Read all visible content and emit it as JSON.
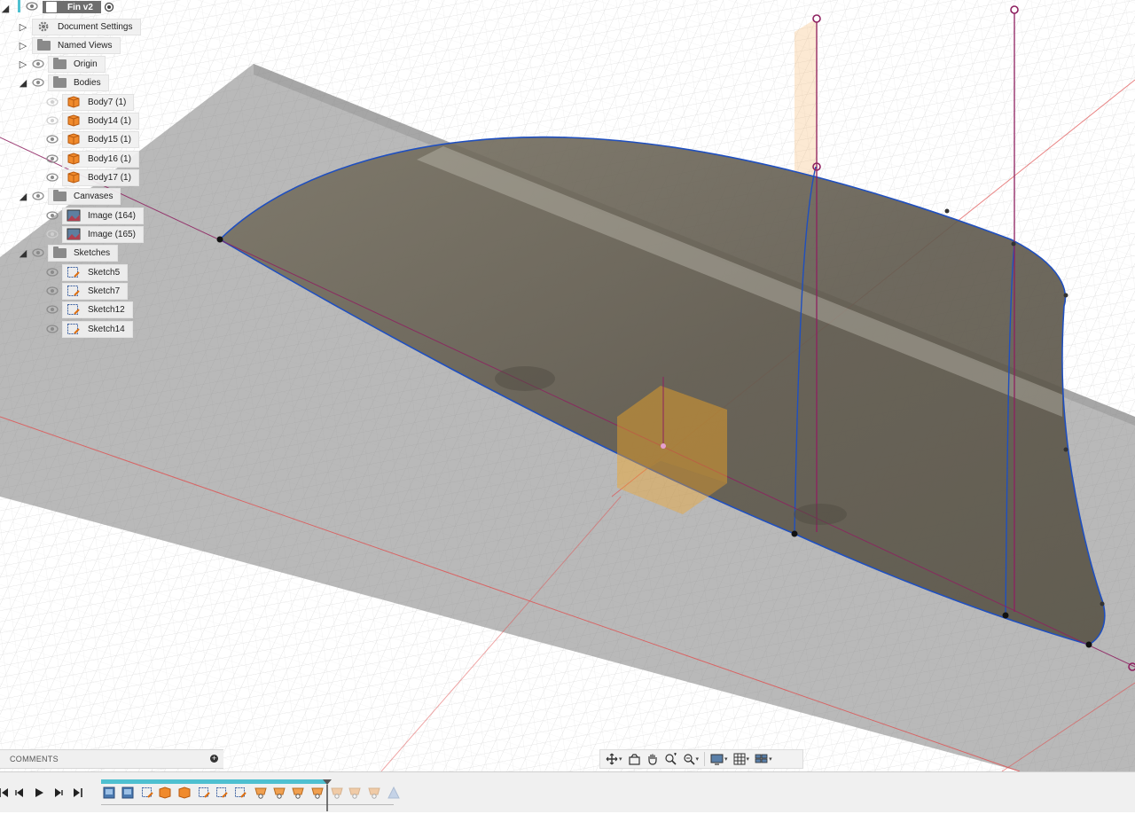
{
  "document": {
    "title": "Fin v2"
  },
  "browser": {
    "items": [
      {
        "label": "Document Settings",
        "icon": "gear-icon"
      },
      {
        "label": "Named Views",
        "icon": "folder-icon"
      },
      {
        "label": "Origin",
        "icon": "folder-icon"
      },
      {
        "label": "Bodies",
        "icon": "folder-icon"
      },
      {
        "label": "Body7 (1)",
        "icon": "body-icon"
      },
      {
        "label": "Body14 (1)",
        "icon": "body-icon"
      },
      {
        "label": "Body15 (1)",
        "icon": "body-icon"
      },
      {
        "label": "Body16 (1)",
        "icon": "body-icon"
      },
      {
        "label": "Body17 (1)",
        "icon": "body-icon"
      },
      {
        "label": "Canvases",
        "icon": "folder-icon"
      },
      {
        "label": "Image (164)",
        "icon": "image-icon"
      },
      {
        "label": "Image (165)",
        "icon": "image-icon"
      },
      {
        "label": "Sketches",
        "icon": "folder-icon"
      },
      {
        "label": "Sketch5",
        "icon": "sketch-icon"
      },
      {
        "label": "Sketch7",
        "icon": "sketch-icon"
      },
      {
        "label": "Sketch12",
        "icon": "sketch-icon"
      },
      {
        "label": "Sketch14",
        "icon": "sketch-icon"
      }
    ]
  },
  "comments": {
    "label": "COMMENTS"
  },
  "navbar": {
    "tools": [
      "orbit-icon",
      "look-at-icon",
      "pan-icon",
      "zoom-window-icon",
      "zoom-icon",
      "display-settings-icon",
      "grid-settings-icon",
      "viewports-icon"
    ]
  },
  "timeline": {
    "controls": [
      "go-to-start-icon",
      "step-back-icon",
      "play-icon",
      "step-forward-icon",
      "go-to-end-icon"
    ],
    "features": [
      "canvas-icon",
      "canvas-icon",
      "sketch-icon",
      "body-icon",
      "body-icon",
      "sketch-icon",
      "sketch-icon",
      "sketch-icon",
      "loft-icon",
      "loft-icon",
      "loft-icon",
      "loft-icon",
      "loft-icon",
      "loft-icon",
      "loft-icon",
      "sketch-icon"
    ]
  },
  "colors": {
    "accent": "#4ec0d0",
    "body": "#6b6557",
    "edge": "#1f4fbf",
    "axis_red": "#e05050",
    "axis_purple": "#8e2060",
    "orange": "#f5a623"
  }
}
